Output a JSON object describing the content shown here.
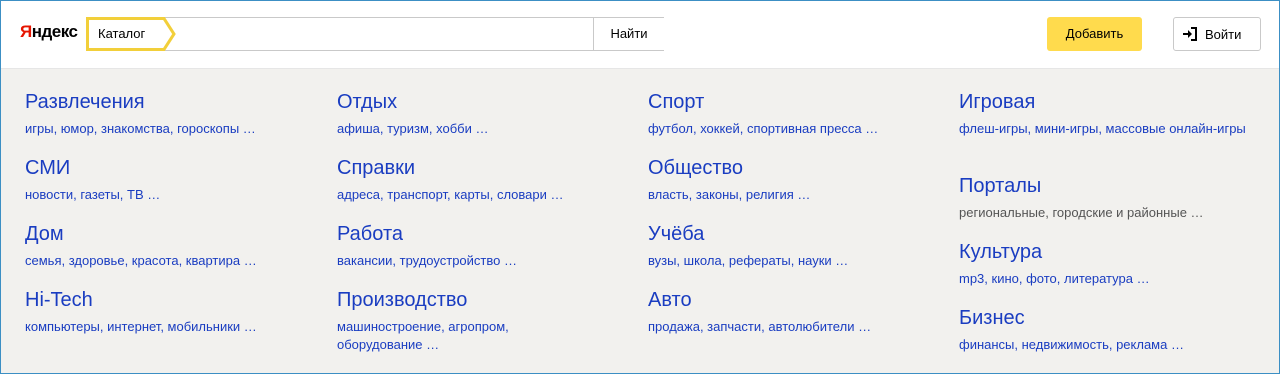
{
  "header": {
    "logo_first": "Я",
    "logo_rest": "ндекс",
    "search": {
      "section_label": "Каталог",
      "value": "",
      "button": "Найти"
    },
    "add_button": "Добавить",
    "login_button": "Войти"
  },
  "columns": [
    [
      {
        "title": "Развлечения",
        "subtitle": "игры, юмор, знакомства, гороскопы …"
      },
      {
        "title": "СМИ",
        "subtitle": "новости, газеты, ТВ …"
      },
      {
        "title": "Дом",
        "subtitle": "семья, здоровье, красота, квартира …"
      },
      {
        "title": "Hi-Tech",
        "subtitle": "компьютеры, интернет, мобильники …"
      }
    ],
    [
      {
        "title": "Отдых",
        "subtitle": "афиша, туризм, хобби …"
      },
      {
        "title": "Справки",
        "subtitle": "адреса, транспорт, карты, словари …"
      },
      {
        "title": "Работа",
        "subtitle": "вакансии, трудоустройство …"
      },
      {
        "title": "Производство",
        "subtitle": "машиностроение, агропром, оборудование …"
      }
    ],
    [
      {
        "title": "Спорт",
        "subtitle": "футбол, хоккей, спортивная пресса …"
      },
      {
        "title": "Общество",
        "subtitle": "власть, законы, религия …"
      },
      {
        "title": "Учёба",
        "subtitle": "вузы, школа, рефераты, науки …"
      },
      {
        "title": "Авто",
        "subtitle": "продажа, запчасти, автолюбители …"
      }
    ],
    [
      {
        "title": "Игровая",
        "subtitle": "флеш-игры, мини-игры, массовые онлайн-игры"
      },
      {
        "title": "Порталы",
        "subtitle": "региональные, городские и районные …"
      },
      {
        "title": "Культура",
        "subtitle": "mp3, кино, фото, литература …"
      },
      {
        "title": "Бизнес",
        "subtitle": "финансы, недвижимость, реклама …"
      }
    ]
  ],
  "colors": {
    "link": "#1a3dc1",
    "accent": "#ffdb4d",
    "logo_red": "#e61400",
    "tag_border": "#f2cf3a"
  },
  "icons": {
    "login": "login-arrow-icon"
  }
}
